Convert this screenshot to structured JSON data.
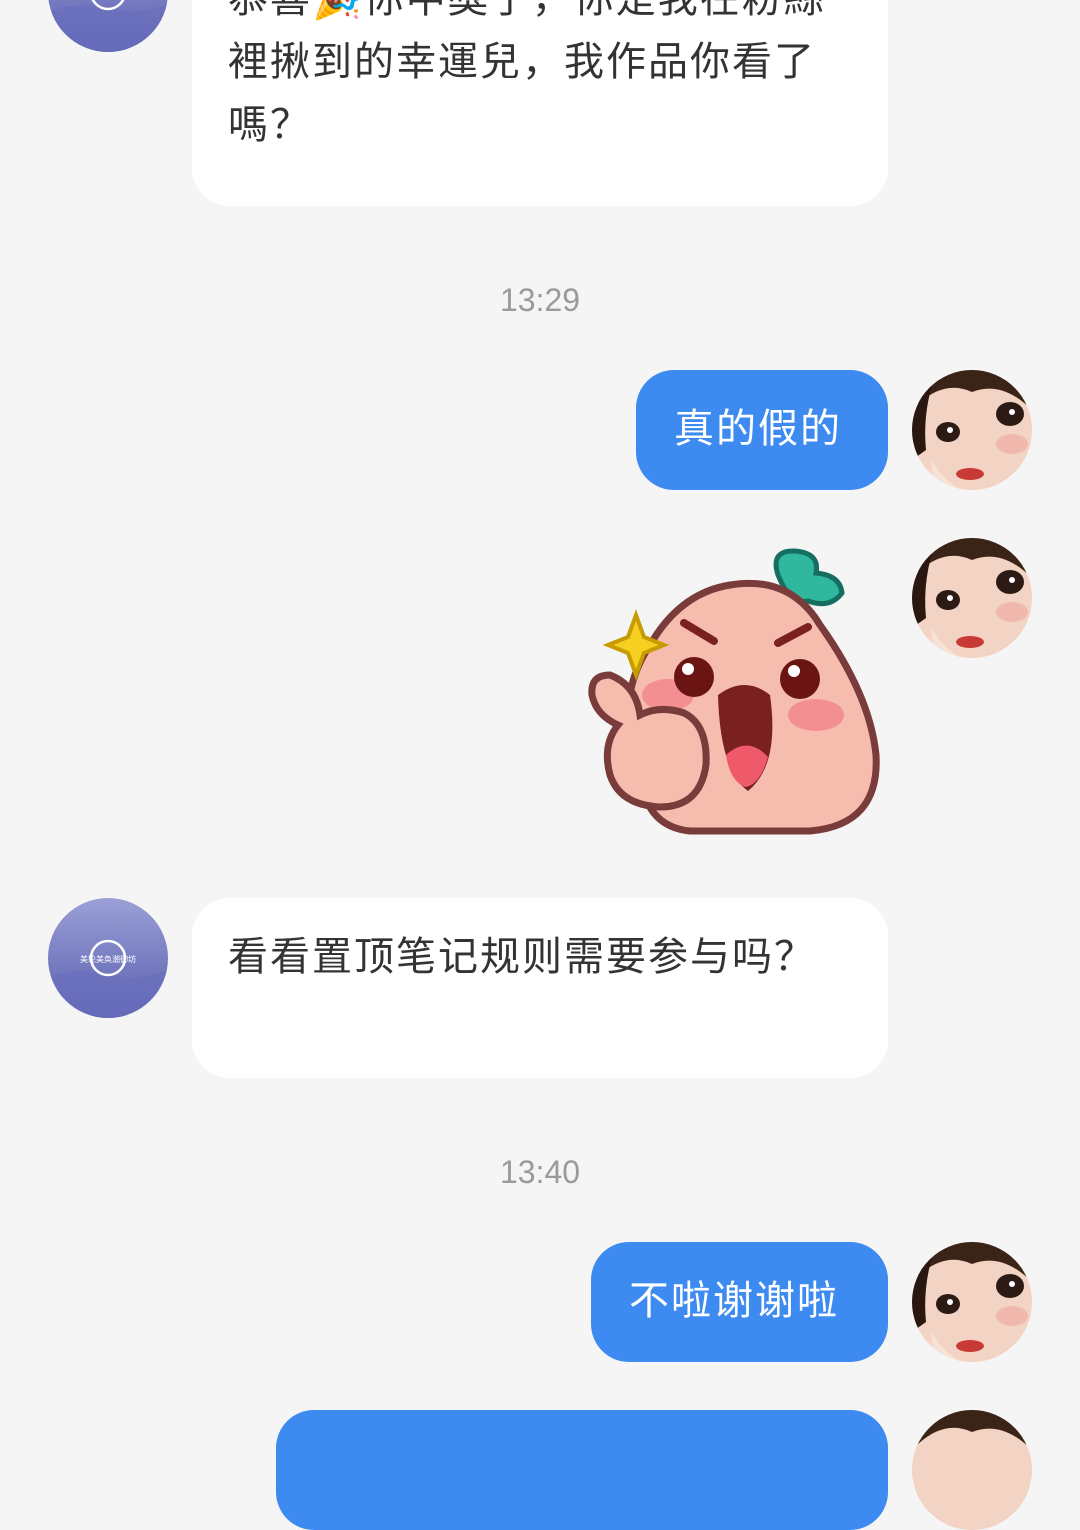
{
  "messages": [
    {
      "id": "m1",
      "sender": "shop",
      "text": "恭喜🎉你中獎了，你是我在粉絲裡揪到的幸運兒，我作品你看了嗎？"
    },
    {
      "id": "t1",
      "type": "timestamp",
      "text": "13:29"
    },
    {
      "id": "m2",
      "sender": "me",
      "text": "真的假的"
    },
    {
      "id": "m3",
      "sender": "me",
      "type": "sticker",
      "sticker": "peach-thumbs-up-sticker"
    },
    {
      "id": "m4",
      "sender": "shop",
      "text": "看看置顶笔记规则需要参与吗？"
    },
    {
      "id": "t2",
      "type": "timestamp",
      "text": "13:40"
    },
    {
      "id": "m5",
      "sender": "me",
      "text": "不啦谢谢啦"
    }
  ],
  "shop_avatar": {
    "text": "美轮美奂潮御坊",
    "colors": {
      "top": "#8f94cf",
      "bottom": "#5a5fb0"
    }
  },
  "colors": {
    "background": "#f5f5f5",
    "incoming_bubble": "#ffffff",
    "outgoing_bubble": "#3d8af0",
    "timestamp": "#9a9a9a"
  }
}
